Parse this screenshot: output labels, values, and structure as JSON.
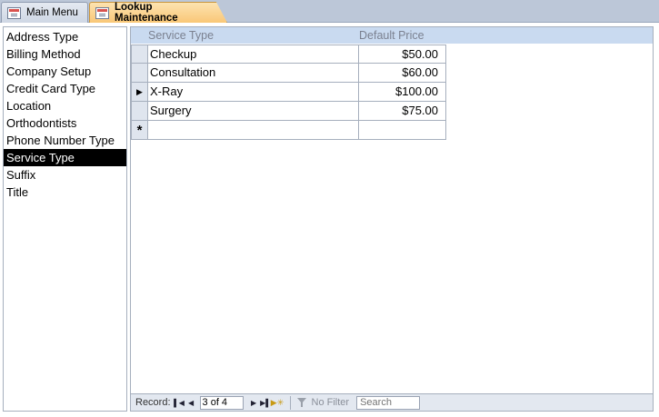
{
  "tabs": [
    {
      "label": "Main Menu",
      "active": false
    },
    {
      "label": "Lookup Maintenance",
      "active": true
    }
  ],
  "lookup_list": {
    "items": [
      "Address Type",
      "Billing Method",
      "Company Setup",
      "Credit Card Type",
      "Location",
      "Orthodontists",
      "Phone Number Type",
      "Service Type",
      "Suffix",
      "Title"
    ],
    "selected_index": 7
  },
  "grid": {
    "columns": {
      "service_type": "Service Type",
      "default_price": "Default Price"
    },
    "rows": [
      {
        "service_type": "Checkup",
        "default_price": "$50.00",
        "current": false
      },
      {
        "service_type": "Consultation",
        "default_price": "$60.00",
        "current": false
      },
      {
        "service_type": "X-Ray",
        "default_price": "$100.00",
        "current": true
      },
      {
        "service_type": "Surgery",
        "default_price": "$75.00",
        "current": false
      }
    ],
    "new_row_marker": "*"
  },
  "navigator": {
    "record_label": "Record:",
    "position_value": "3 of 4",
    "filter_label": "No Filter",
    "search_placeholder": "Search"
  },
  "icons": {
    "tab": "form-icon",
    "current_record": "record-pointer-icon",
    "first": "first-record-icon",
    "previous": "previous-record-icon",
    "next": "next-record-icon",
    "last": "last-record-icon",
    "new": "new-record-icon",
    "filter": "filter-icon"
  },
  "colors": {
    "active_tab": "#f9c777",
    "selected_item_bg": "#000000",
    "grid_header_bg": "#c9daf0"
  }
}
